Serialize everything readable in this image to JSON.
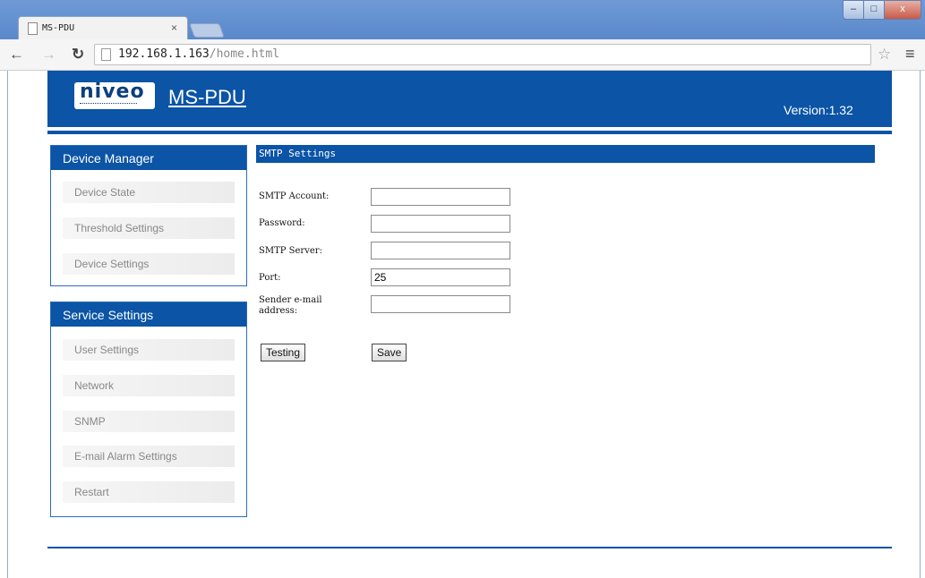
{
  "browser": {
    "tab_title": "MS-PDU",
    "tab_close": "×",
    "url_host": "192.168.1.163",
    "url_path": "/home.html",
    "back_icon": "arrow-left",
    "forward_icon": "arrow-right",
    "reload_icon": "reload",
    "bookmark_icon": "star-outline",
    "menu_icon": "hamburger",
    "window_buttons": {
      "minimize": "–",
      "maximize": "□",
      "close": "x"
    }
  },
  "header": {
    "logo_text": "niveo",
    "app_name": "MS-PDU",
    "version": "Version:1.32",
    "brand_color": "#0b54a6"
  },
  "sidebar": {
    "device_manager": {
      "title": "Device Manager",
      "items": [
        "Device State",
        "Threshold Settings",
        "Device Settings"
      ]
    },
    "service_settings": {
      "title": "Service Settings",
      "items": [
        "User Settings",
        "Network",
        "SNMP",
        "E-mail Alarm Settings",
        "Restart"
      ]
    }
  },
  "main": {
    "section_title": "SMTP Settings",
    "fields": {
      "smtp_account": {
        "label": "SMTP Account:",
        "value": ""
      },
      "password": {
        "label": "Password:",
        "value": ""
      },
      "smtp_server": {
        "label": "SMTP Server:",
        "value": ""
      },
      "port": {
        "label": "Port:",
        "value": "25"
      },
      "sender_email": {
        "label_line1": "Sender e-mail",
        "label_line2": "address:",
        "value": ""
      }
    },
    "buttons": {
      "testing": "Testing",
      "save": "Save"
    }
  }
}
